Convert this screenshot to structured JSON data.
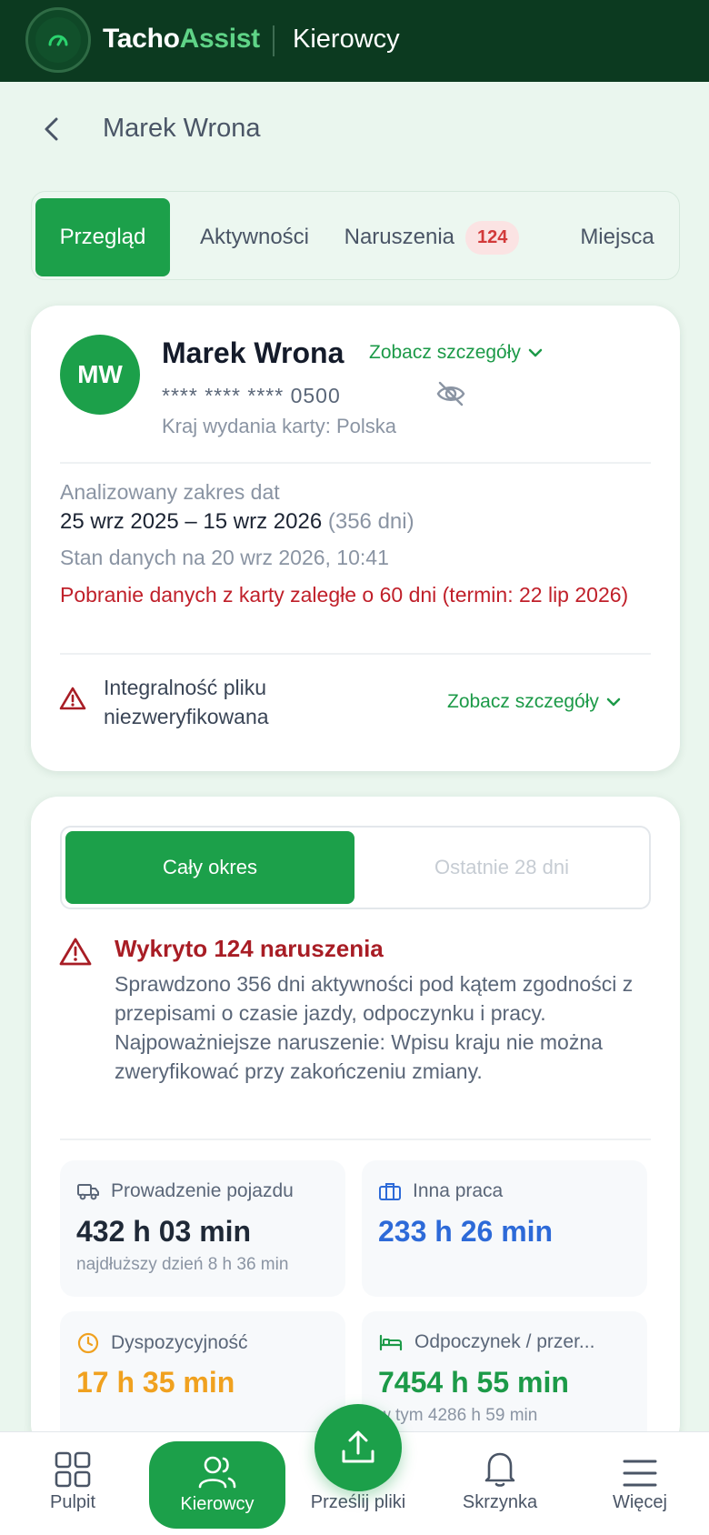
{
  "app": {
    "brand_part1": "Tacho",
    "brand_part2": "Assist",
    "section": "Kierowcy",
    "colors": {
      "brand_green": "#1ca04a",
      "dark_header": "#0c3a20",
      "danger": "#c0202a",
      "blue": "#2d6ad8",
      "orange": "#f0a11f"
    }
  },
  "header": {
    "title": "Marek Wrona",
    "back_icon": "chevron-left-icon"
  },
  "tabs": [
    {
      "label": "Przegląd",
      "active": true
    },
    {
      "label": "Aktywności",
      "active": false
    },
    {
      "label": "Naruszenia",
      "badge": "124",
      "active": false
    },
    {
      "label": "Miejsca",
      "active": false
    }
  ],
  "driver": {
    "initials": "MW",
    "name": "Marek Wrona",
    "details_label": "Zobacz szczegóły",
    "card_number": "**** **** **** 0500",
    "issue_country": "Kraj wydania karty: Polska",
    "range_label": "Analizowany zakres dat",
    "range_value": "25 wrz 2025 – 15 wrz 2026",
    "range_days": "(356 dni)",
    "data_state": "Stan danych na 20 wrz 2026, 10:41",
    "overdue": "Pobranie danych z karty zaległe o 60 dni (termin: 22 lip 2026)",
    "integrity": "Integralność pliku niezweryfikowana",
    "integrity_details": "Zobacz szczegóły"
  },
  "summary": {
    "period_toggle": [
      "Cały okres",
      "Ostatnie 28 dni"
    ],
    "alert_title": "Wykryto 124 naruszenia",
    "alert_body": "Sprawdzono 356 dni aktywności pod kątem zgodności z przepisami o czasie jazdy, odpoczynku i pracy. Najpoważniejsze naruszenie: Wpisu kraju nie można zweryfikować przy zakończeniu zmiany.",
    "stats": [
      {
        "label": "Prowadzenie pojazdu",
        "value": "432 h 03 min",
        "sub": "najdłuższy dzień 8 h 36 min",
        "icon": "truck-icon"
      },
      {
        "label": "Inna praca",
        "value": "233 h 26 min",
        "sub": "",
        "icon": "briefcase-icon"
      },
      {
        "label": "Dyspozycyjność",
        "value": "17 h 35 min",
        "sub": "",
        "icon": "clock-icon"
      },
      {
        "label": "Odpoczynek / przer...",
        "value": "7454 h 55 min",
        "sub": "w tym 4286 h 59 min",
        "icon": "bed-icon"
      }
    ]
  },
  "bottom_nav": [
    {
      "label": "Pulpit",
      "icon": "grid-icon"
    },
    {
      "label": "Kierowcy",
      "icon": "users-icon",
      "active": true
    },
    {
      "label": "Prześlij pliki",
      "icon": "upload-icon"
    },
    {
      "label": "Skrzynka",
      "icon": "bell-icon"
    },
    {
      "label": "Więcej",
      "icon": "menu-icon"
    }
  ]
}
